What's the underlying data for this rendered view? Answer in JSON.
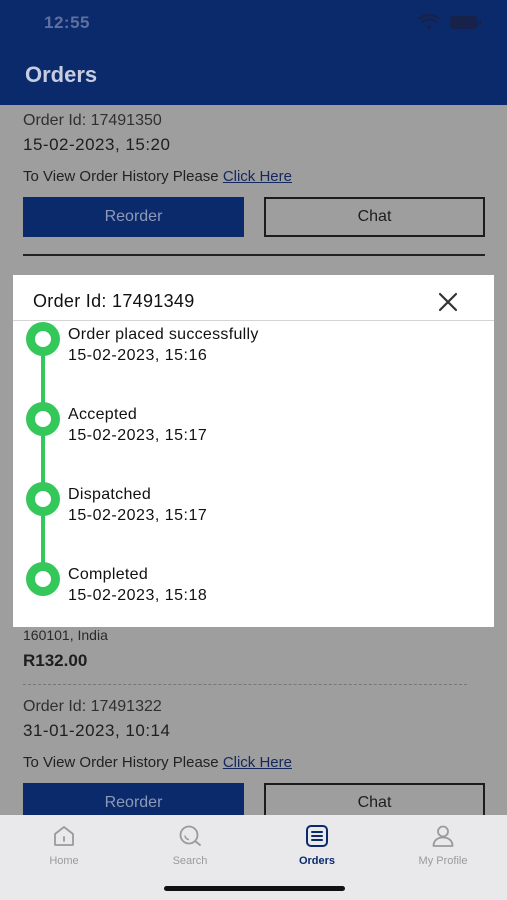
{
  "status_bar": {
    "time": "12:55"
  },
  "header": {
    "title": "Orders"
  },
  "orders": [
    {
      "order_id": "Order Id: 17491350",
      "date": "15-02-2023, 15:20",
      "history_text": "To View Order History Please",
      "history_link": "Click Here",
      "reorder_label": "Reorder",
      "chat_label": "Chat"
    },
    {
      "order_id": "Order Id: 17491322",
      "date": "31-01-2023, 10:14",
      "history_text": "To View Order History Please",
      "history_link": "Click Here",
      "reorder_label": "Reorder",
      "chat_label": "Chat"
    }
  ],
  "partial_order": {
    "address": "160101, India",
    "price": "R132.00"
  },
  "modal": {
    "title": "Order Id: 17491349",
    "steps": [
      {
        "label": "Order placed successfully",
        "time": "15-02-2023, 15:16"
      },
      {
        "label": "Accepted",
        "time": "15-02-2023, 15:17"
      },
      {
        "label": "Dispatched",
        "time": "15-02-2023, 15:17"
      },
      {
        "label": "Completed",
        "time": "15-02-2023, 15:18"
      }
    ]
  },
  "bottom_nav": {
    "items": [
      {
        "label": "Home",
        "icon": "home-icon"
      },
      {
        "label": "Search",
        "icon": "search-icon"
      },
      {
        "label": "Orders",
        "icon": "orders-icon",
        "active": true
      },
      {
        "label": "My Profile",
        "icon": "profile-icon"
      }
    ]
  },
  "colors": {
    "primary": "#0b2a6b",
    "timeline": "#34c759",
    "overlay": "#9e9e9e"
  }
}
